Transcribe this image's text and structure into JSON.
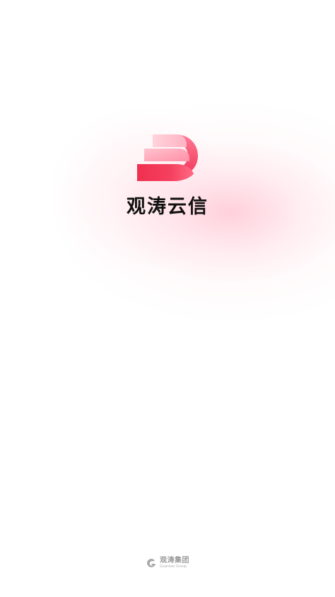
{
  "app": {
    "name": "观涛云信"
  },
  "footer": {
    "company": "观涛集团",
    "company_en": "Guantao Group",
    "icon": "company-logo-icon"
  },
  "colors": {
    "brand_primary": "#f0365a",
    "brand_light": "#ffb8c6",
    "glow": "#ffc3cf"
  }
}
